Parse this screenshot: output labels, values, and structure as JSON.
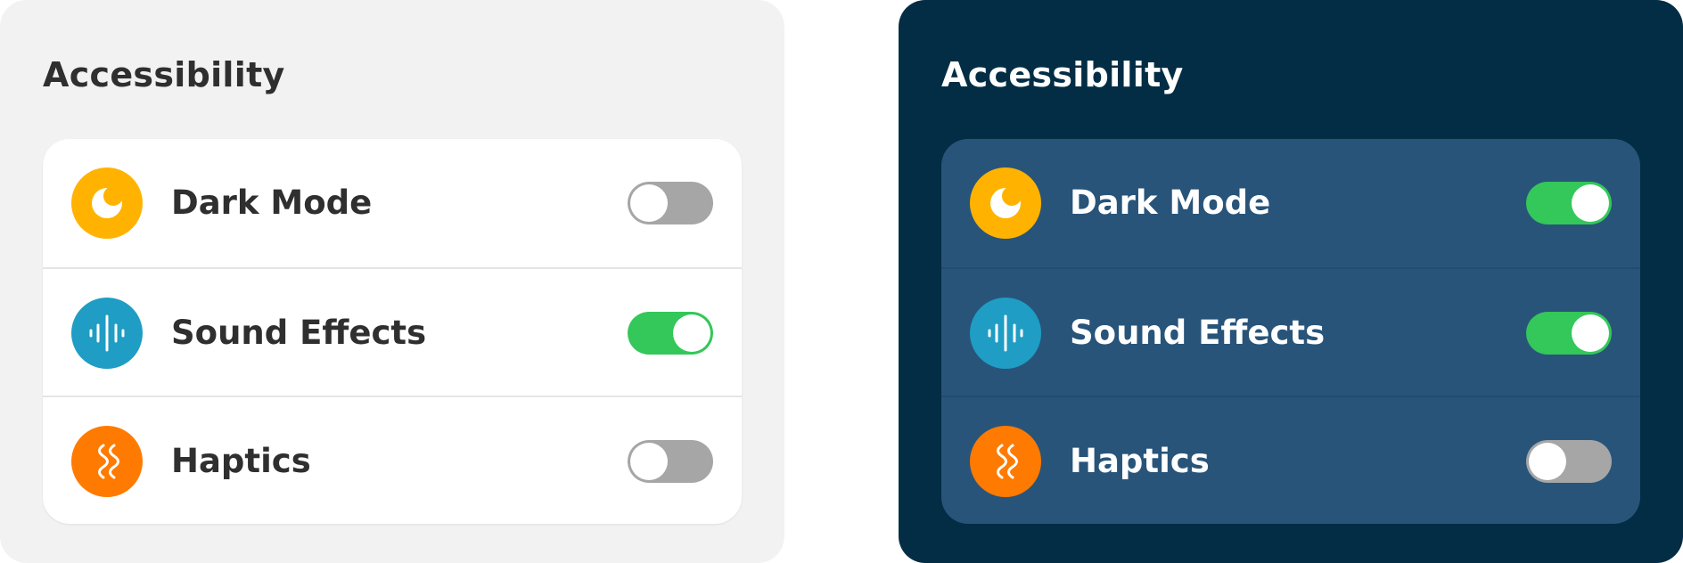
{
  "panels": [
    {
      "theme": "light",
      "title": "Accessibility",
      "items": [
        {
          "label": "Dark Mode",
          "icon": "moon-icon",
          "icon_color": "#ffb300",
          "enabled": false
        },
        {
          "label": "Sound Effects",
          "icon": "sound-wave-icon",
          "icon_color": "#1f9dc4",
          "enabled": true
        },
        {
          "label": "Haptics",
          "icon": "vibration-icon",
          "icon_color": "#ff7a00",
          "enabled": false
        }
      ]
    },
    {
      "theme": "dark",
      "title": "Accessibility",
      "items": [
        {
          "label": "Dark Mode",
          "icon": "moon-icon",
          "icon_color": "#ffb300",
          "enabled": true
        },
        {
          "label": "Sound Effects",
          "icon": "sound-wave-icon",
          "icon_color": "#1f9dc4",
          "enabled": true
        },
        {
          "label": "Haptics",
          "icon": "vibration-icon",
          "icon_color": "#ff7a00",
          "enabled": false
        }
      ]
    }
  ],
  "colors": {
    "toggle_on": "#34c759",
    "toggle_off": "#a6a6a6",
    "dark_panel_bg": "#032d44",
    "dark_card_bg": "#28547a",
    "light_panel_bg": "#f2f2f2"
  }
}
